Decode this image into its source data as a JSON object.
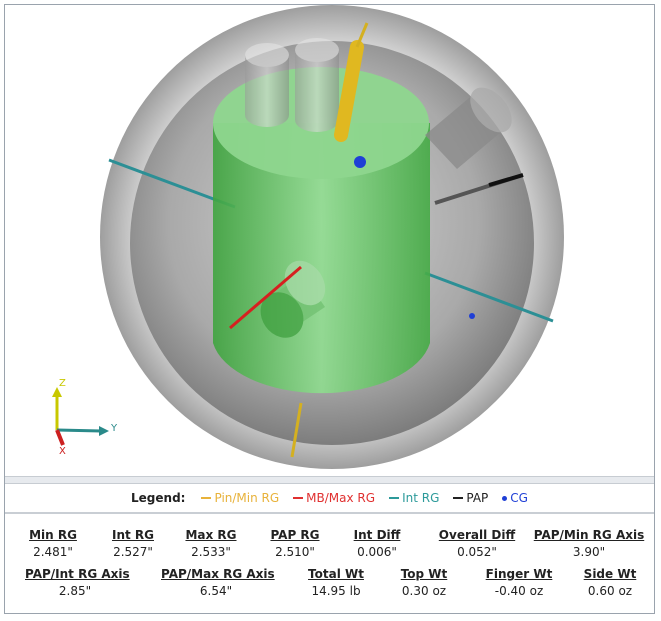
{
  "axes_triad": {
    "z": "Z",
    "y": "Y",
    "x": "X"
  },
  "legend": {
    "title": "Legend:",
    "items": [
      {
        "label": "Pin/Min RG",
        "color": "#e8b23a",
        "kind": "line"
      },
      {
        "label": "MB/Max RG",
        "color": "#e03030",
        "kind": "line"
      },
      {
        "label": "Int RG",
        "color": "#2c9a9a",
        "kind": "line"
      },
      {
        "label": "PAP",
        "color": "#222222",
        "kind": "line"
      },
      {
        "label": "CG",
        "color": "#1f3fd6",
        "kind": "dot"
      }
    ]
  },
  "stats": {
    "min_rg": {
      "label": "Min RG",
      "value": "2.481\""
    },
    "int_rg": {
      "label": "Int RG",
      "value": "2.527\""
    },
    "max_rg": {
      "label": "Max RG",
      "value": "2.533\""
    },
    "pap_rg": {
      "label": "PAP RG",
      "value": "2.510\""
    },
    "int_diff": {
      "label": "Int Diff",
      "value": "0.006\""
    },
    "overall_diff": {
      "label": "Overall Diff",
      "value": "0.052\""
    },
    "pap_min_rg_axis": {
      "label": "PAP/Min RG Axis",
      "value": "3.90\""
    },
    "pap_int_rg_axis": {
      "label": "PAP/Int RG Axis",
      "value": "2.85\""
    },
    "pap_max_rg_axis": {
      "label": "PAP/Max RG Axis",
      "value": "6.54\""
    },
    "total_wt": {
      "label": "Total Wt",
      "value": "14.95 lb"
    },
    "top_wt": {
      "label": "Top Wt",
      "value": "0.30 oz"
    },
    "finger_wt": {
      "label": "Finger Wt",
      "value": "-0.40 oz"
    },
    "side_wt": {
      "label": "Side Wt",
      "value": "0.60 oz"
    }
  }
}
